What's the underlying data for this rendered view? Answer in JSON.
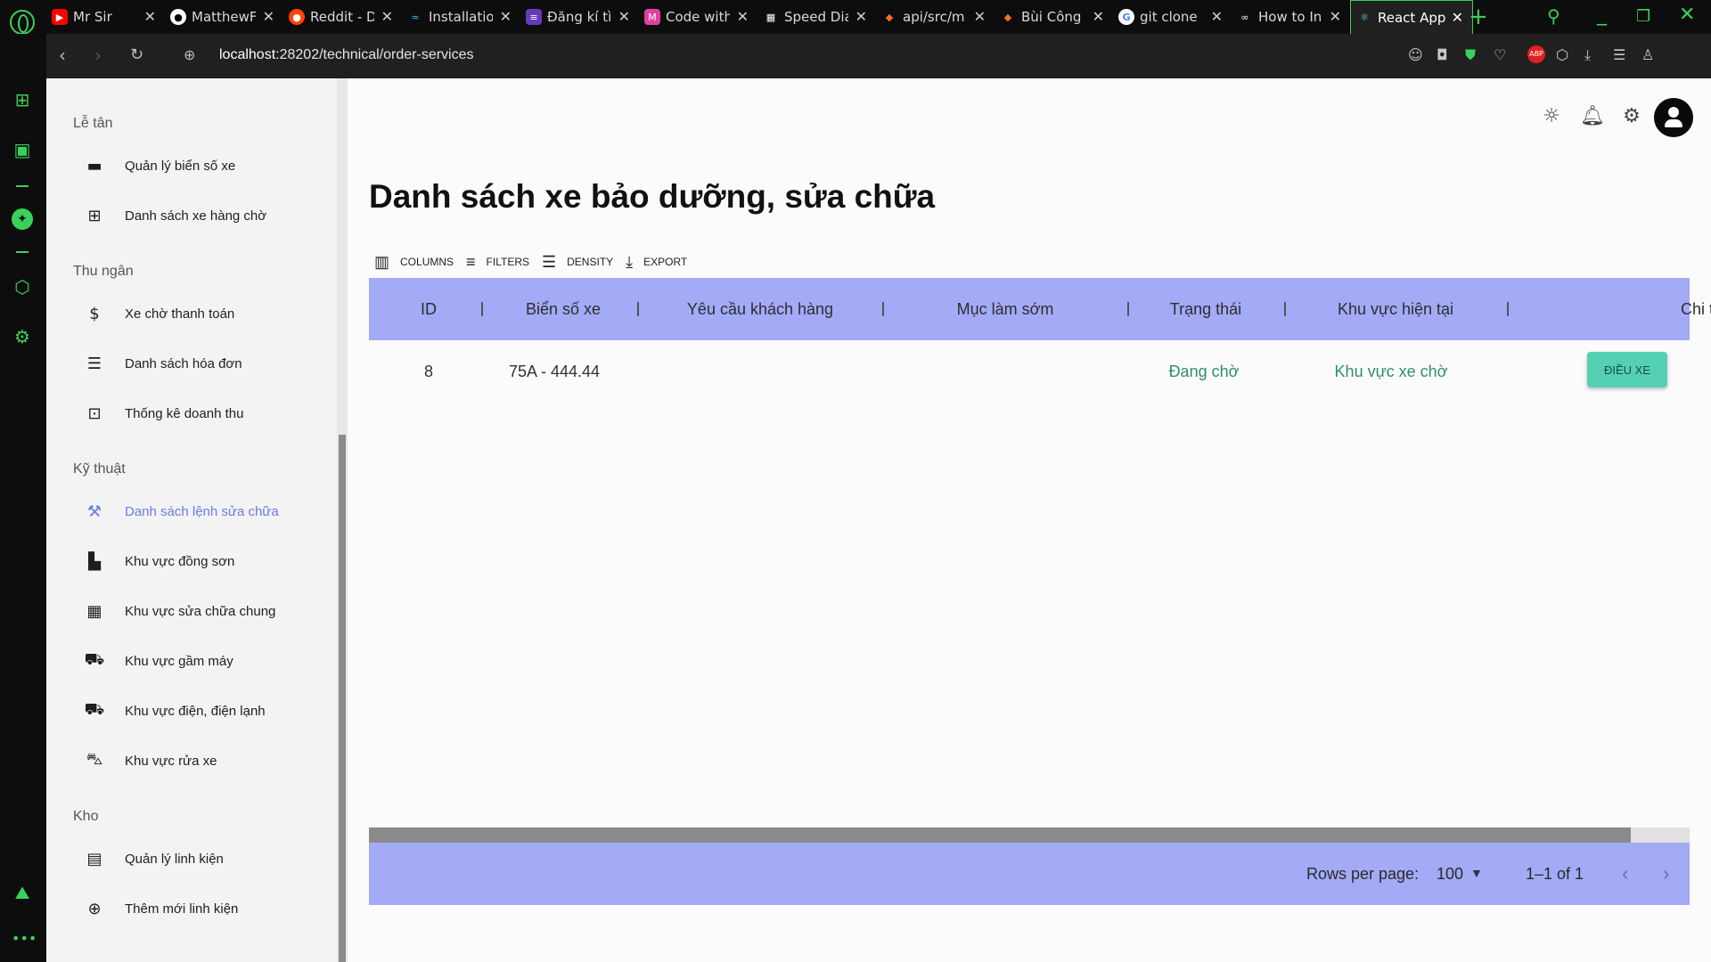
{
  "browser": {
    "tabs": [
      {
        "title": "Mr Sir",
        "icon": "youtube-icon",
        "color": "#ff0000"
      },
      {
        "title": "MatthewF",
        "icon": "github-icon",
        "color": "#ffffff"
      },
      {
        "title": "Reddit - D",
        "icon": "reddit-icon",
        "color": "#ff4500"
      },
      {
        "title": "Installatio",
        "icon": "tailwind-icon",
        "color": "#38bdf8"
      },
      {
        "title": "Đăng kí tì",
        "icon": "form-icon",
        "color": "#673ab7"
      },
      {
        "title": "Code with",
        "icon": "codewith-icon",
        "color": "#e040a0"
      },
      {
        "title": "Speed Dia",
        "icon": "speed-dial-icon",
        "color": "#ffffff"
      },
      {
        "title": "api/src/m",
        "icon": "gitlab-icon",
        "color": "#fc6d26"
      },
      {
        "title": "Bùi Công",
        "icon": "gitlab-icon",
        "color": "#fc6d26"
      },
      {
        "title": "git clone",
        "icon": "google-icon",
        "color": "#4285f4"
      },
      {
        "title": "How to In",
        "icon": "glasses-icon",
        "color": "#ffffff"
      },
      {
        "title": "React App",
        "icon": "react-icon",
        "color": "#61dafb"
      }
    ],
    "url_host": "localhost",
    "url_rest": ":28202/technical/order-services"
  },
  "sidebar": {
    "sections": [
      {
        "title": "Lễ tân",
        "items": [
          {
            "label": "Quản lý biển số xe",
            "icon": "license-plate-icon"
          },
          {
            "label": "Danh sách xe hàng chờ",
            "icon": "queue-add-icon"
          }
        ]
      },
      {
        "title": "Thu ngân",
        "items": [
          {
            "label": "Xe chờ thanh toán",
            "icon": "payment-pending-icon"
          },
          {
            "label": "Danh sách hóa đơn",
            "icon": "invoice-list-icon"
          },
          {
            "label": "Thống kê doanh thu",
            "icon": "revenue-icon"
          }
        ]
      },
      {
        "title": "Kỹ thuật",
        "items": [
          {
            "label": "Danh sách lệnh sửa chữa",
            "icon": "repair-order-icon",
            "active": true
          },
          {
            "label": "Khu vực đồng sơn",
            "icon": "paint-roller-icon"
          },
          {
            "label": "Khu vực sửa chữa chung",
            "icon": "general-repair-icon"
          },
          {
            "label": "Khu vực gầm máy",
            "icon": "undercarriage-icon"
          },
          {
            "label": "Khu vực điện, điện lạnh",
            "icon": "electrical-icon"
          },
          {
            "label": "Khu vực rửa xe",
            "icon": "car-wash-icon"
          }
        ]
      },
      {
        "title": "Kho",
        "items": [
          {
            "label": "Quản lý linh kiện",
            "icon": "archive-icon"
          },
          {
            "label": "Thêm mới linh kiện",
            "icon": "add-circle-icon"
          }
        ]
      }
    ]
  },
  "main": {
    "title": "Danh sách xe bảo dưỡng, sửa chữa",
    "toolbar": {
      "columns": "COLUMNS",
      "filters": "FILTERS",
      "density": "DENSITY",
      "export": "EXPORT"
    },
    "columns": [
      "ID",
      "Biển số xe",
      "Yêu cầu khách hàng",
      "Mục làm sớm",
      "Trạng thái",
      "Khu vực hiện tại",
      "Chi tiết"
    ],
    "rows": [
      {
        "id": "8",
        "plate": "75A - 444.44",
        "request": "",
        "early": "",
        "status": "Đang chờ",
        "area": "Khu vực xe chờ",
        "action": "ĐIỀU XE"
      }
    ],
    "footer": {
      "rows_per_page_label": "Rows per page:",
      "rows_per_page_value": "100",
      "range": "1–1 of 1"
    }
  },
  "colors": {
    "accent": "#6c7ce3",
    "grid_header": "#a3aaf6",
    "status_text": "#2f8f6a",
    "action_button": "#54d1b4",
    "opera_green": "#3ad15a"
  }
}
